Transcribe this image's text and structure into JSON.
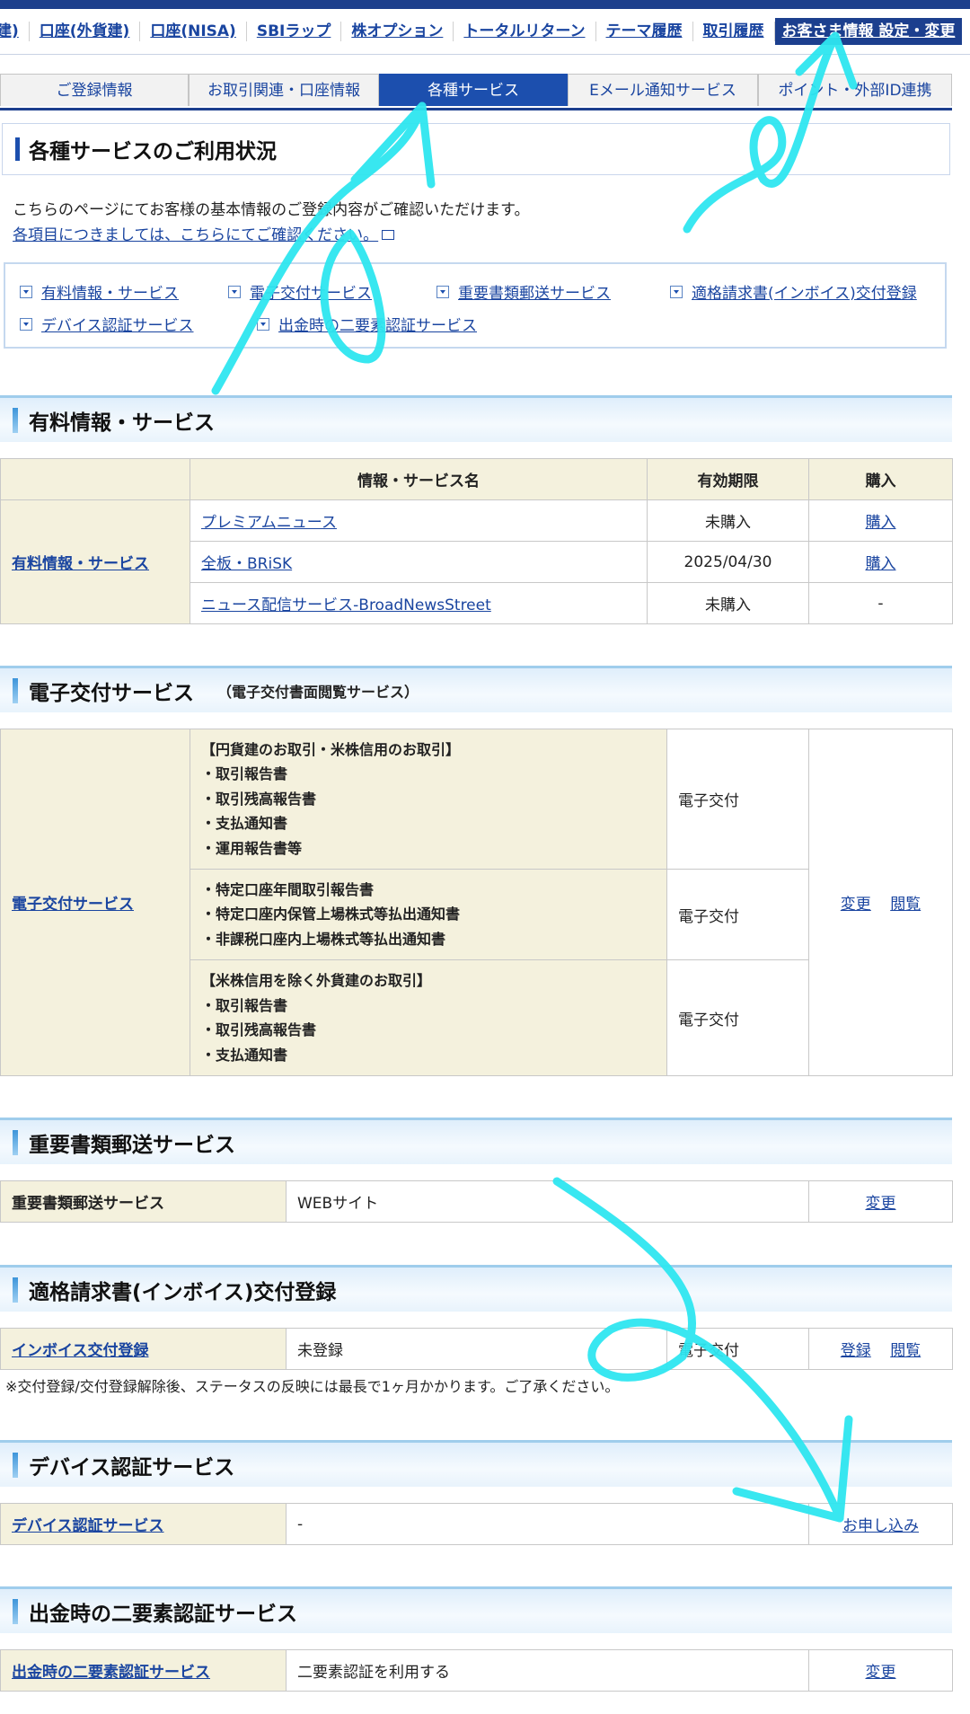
{
  "topnav": {
    "items": [
      "建)",
      "口座(外貨建)",
      "口座(NISA)",
      "SBIラップ",
      "株オプション",
      "トータルリターン",
      "テーマ履歴",
      "取引履歴"
    ],
    "active": "お客さま情報 設定・変更"
  },
  "tabs": [
    "ご登録情報",
    "お取引関連・口座情報",
    "各種サービス",
    "Eメール通知サービス",
    "ポイント・外部ID連携"
  ],
  "active_tab": "各種サービス",
  "main": {
    "title": "各種サービスのご利用状況",
    "intro": "こちらのページにてお客様の基本情報のご登録内容がご確認いただけます。",
    "intro_link": "各項目につきましては、こちらにてご確認ください。"
  },
  "quicknav": [
    "有料情報・サービス",
    "電子交付サービス",
    "重要書類郵送サービス",
    "適格請求書(インボイス)交付登録",
    "デバイス認証サービス",
    "出金時の二要素認証サービス"
  ],
  "paid": {
    "title": "有料情報・サービス",
    "headers": [
      "情報・サービス名",
      "有効期限",
      "購入"
    ],
    "label": "有料情報・サービス",
    "rows": [
      {
        "name": "プレミアムニュース",
        "expiry": "未購入",
        "action": "購入"
      },
      {
        "name": "全板・BRiSK",
        "expiry": "2025/04/30",
        "action": "購入"
      },
      {
        "name": "ニュース配信サービス-BroadNewsStreet",
        "expiry": "未購入",
        "action": "-"
      }
    ]
  },
  "edelivery": {
    "title": "電子交付サービス",
    "subtitle": "（電子交付書面閲覧サービス）",
    "label": "電子交付サービス",
    "groups": [
      {
        "lines": [
          "【円貨建のお取引・米株信用のお取引】",
          "・取引報告書",
          "・取引残高報告書",
          "・支払通知書",
          "・運用報告書等"
        ],
        "status": "電子交付"
      },
      {
        "lines": [
          "・特定口座年間取引報告書",
          "・特定口座内保管上場株式等払出通知書",
          "・非課税口座内上場株式等払出通知書"
        ],
        "status": "電子交付"
      },
      {
        "lines": [
          "【米株信用を除く外貨建のお取引】",
          "・取引報告書",
          "・取引残高報告書",
          "・支払通知書"
        ],
        "status": "電子交付"
      }
    ],
    "action_change": "変更",
    "action_view": "閲覧"
  },
  "mail": {
    "title": "重要書類郵送サービス",
    "label": "重要書類郵送サービス",
    "value": "WEBサイト",
    "action": "変更"
  },
  "invoice": {
    "title": "適格請求書(インボイス)交付登録",
    "label": "インボイス交付登録",
    "value": "未登録",
    "status": "電子交付",
    "action_register": "登録",
    "action_view": "閲覧",
    "note": "※交付登録/交付登録解除後、ステータスの反映には最長で1ヶ月かかります。ご了承ください。"
  },
  "device": {
    "title": "デバイス認証サービス",
    "label": "デバイス認証サービス",
    "value": "-",
    "action": "お申し込み"
  },
  "twofactor": {
    "title": "出金時の二要素認証サービス",
    "label": "出金時の二要素認証サービス",
    "value": "二要素認証を利用する",
    "action": "変更"
  },
  "colors": {
    "nav_blue": "#1c3f8e",
    "link_blue": "#1a45a0",
    "cream": "#f4f1dd",
    "annotation": "#2ee6f0"
  }
}
